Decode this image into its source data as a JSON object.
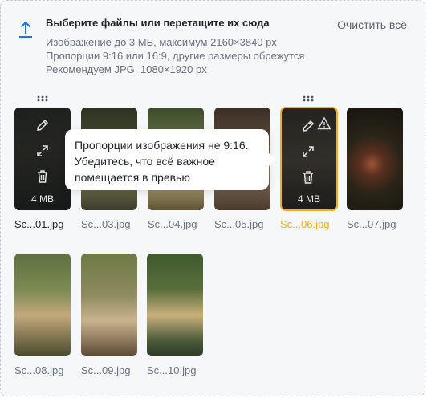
{
  "header": {
    "title": "Выберите файлы или перетащите их сюда",
    "clear_label": "Очистить всё",
    "hints": [
      "Изображение до 3 МБ, максимум 2160×3840 px",
      "Пропорции 9:16 или 16:9, другие размеры обрежутся",
      "Рекомендуем JPG, 1080×1920 px"
    ]
  },
  "files": [
    {
      "name": "Sc...01.jpg",
      "size": "4 MB",
      "state": "hover"
    },
    {
      "name": "Sc...03.jpg"
    },
    {
      "name": "Sc...04.jpg"
    },
    {
      "name": "Sc...05.jpg"
    },
    {
      "name": "Sc...06.jpg",
      "size": "4 MB",
      "state": "warning"
    },
    {
      "name": "Sc...07.jpg"
    },
    {
      "name": "Sc...08.jpg"
    },
    {
      "name": "Sc...09.jpg"
    },
    {
      "name": "Sc...10.jpg"
    }
  ],
  "tooltip": {
    "text": "Пропорции изображения не 9:16. Убедитесь, что всё важное помещается в превью"
  },
  "colors": {
    "accent": "#1a73e8",
    "warning": "#f4ad1b"
  },
  "icons": [
    "upload-icon",
    "edit-icon",
    "expand-icon",
    "trash-icon",
    "warning-icon",
    "drag-handle-icon"
  ]
}
